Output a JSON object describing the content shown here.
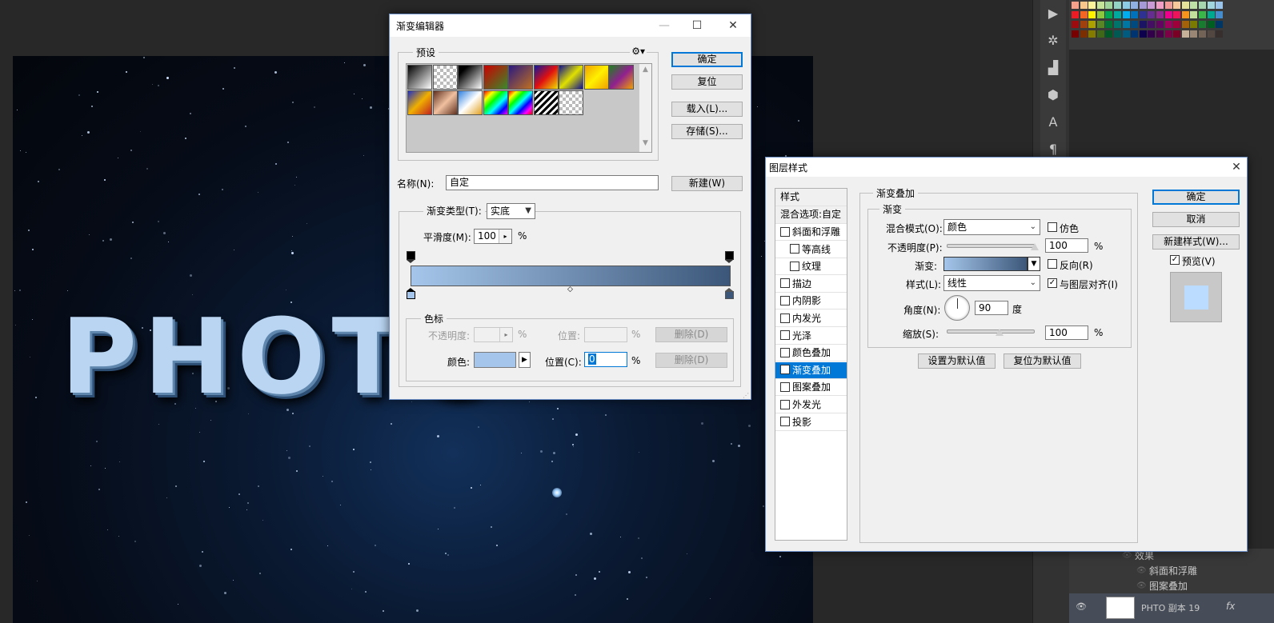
{
  "gradient_editor": {
    "title": "渐变编辑器",
    "ok": "确定",
    "reset": "复位",
    "load": "载入(L)...",
    "save": "存储(S)...",
    "new": "新建(W)",
    "presets_label": "预设",
    "name_label": "名称(N):",
    "name_value": "自定",
    "gradient_type_label": "渐变类型(T):",
    "gradient_type_value": "实底",
    "smoothness_label": "平滑度(M):",
    "smoothness_value": "100",
    "percent": "%",
    "color_stops_label": "色标",
    "opacity_label": "不透明度:",
    "location_label_dim": "位置:",
    "delete": "删除(D)",
    "color_label": "颜色:",
    "location_label": "位置(C):",
    "location_value": "0",
    "stop_color": "#a5c6ea",
    "end_color": "#3b5679"
  },
  "layer_style": {
    "title": "图层样式",
    "styles_header": "样式",
    "blend_options": "混合选项:自定",
    "items": [
      {
        "label": "斜面和浮雕",
        "checked": false
      },
      {
        "label": "等高线",
        "checked": false
      },
      {
        "label": "纹理",
        "checked": false
      },
      {
        "label": "描边",
        "checked": false
      },
      {
        "label": "内阴影",
        "checked": false
      },
      {
        "label": "内发光",
        "checked": false
      },
      {
        "label": "光泽",
        "checked": false
      },
      {
        "label": "颜色叠加",
        "checked": false
      },
      {
        "label": "渐变叠加",
        "checked": true
      },
      {
        "label": "图案叠加",
        "checked": false
      },
      {
        "label": "外发光",
        "checked": false
      },
      {
        "label": "投影",
        "checked": false
      }
    ],
    "section_title": "渐变叠加",
    "subsection_title": "渐变",
    "blend_mode_label": "混合模式(O):",
    "blend_mode_value": "颜色",
    "dither_label": "仿色",
    "opacity_label": "不透明度(P):",
    "opacity_value": "100",
    "percent": "%",
    "gradient_label": "渐变:",
    "reverse_label": "反向(R)",
    "style_label": "样式(L):",
    "style_value": "线性",
    "align_label": "与图层对齐(I)",
    "angle_label": "角度(N):",
    "angle_value": "90",
    "degree": "度",
    "scale_label": "缩放(S):",
    "scale_value": "100",
    "set_default": "设置为默认值",
    "reset_default": "复位为默认值",
    "ok": "确定",
    "cancel": "取消",
    "new_style": "新建样式(W)...",
    "preview_label": "预览(V)",
    "preview_checked": true
  },
  "canvas": {
    "text": "PHOTO"
  },
  "layers": {
    "effects": "效果",
    "effect_1": "斜面和浮雕",
    "effect_2": "图案叠加",
    "layer_name": "PHTO 副本 19",
    "fx": "fx"
  },
  "icons": {
    "close": "close-icon",
    "maximize": "maximize-icon",
    "minimize": "minimize-icon",
    "gear": "gear-icon"
  }
}
